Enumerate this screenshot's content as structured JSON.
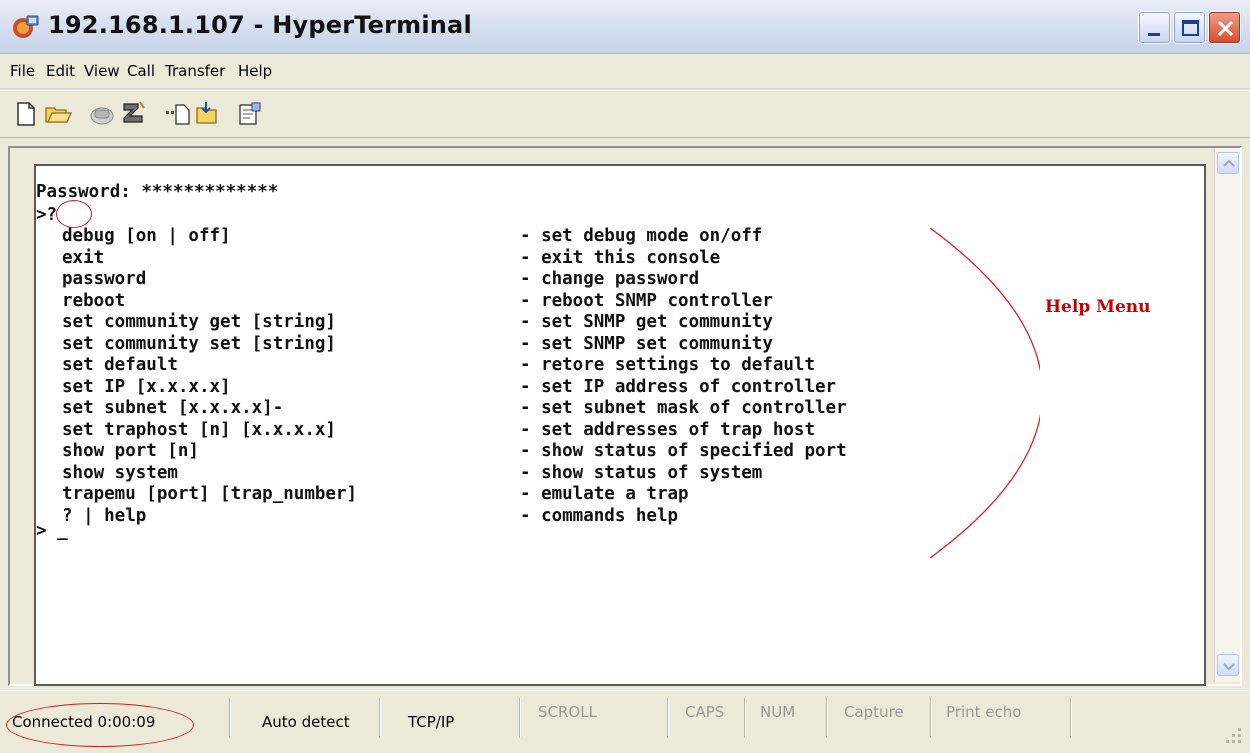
{
  "window": {
    "title": "192.168.1.107 - HyperTerminal",
    "controls": [
      "minimize",
      "maximize",
      "close"
    ]
  },
  "menu": {
    "items": [
      "File",
      "Edit",
      "View",
      "Call",
      "Transfer",
      "Help"
    ]
  },
  "toolbar": {
    "icons": [
      "new-file-icon",
      "open-folder-icon",
      "connect-phone-icon",
      "disconnect-phone-icon",
      "send-icon",
      "receive-icon",
      "properties-icon"
    ]
  },
  "terminal": {
    "password_line": "Password: *************",
    "prompt_help": ">?",
    "commands": [
      {
        "cmd": "debug [on | off]",
        "desc": "- set debug mode on/off"
      },
      {
        "cmd": "exit",
        "desc": "- exit this console"
      },
      {
        "cmd": "password",
        "desc": "- change password"
      },
      {
        "cmd": "reboot",
        "desc": "- reboot SNMP controller"
      },
      {
        "cmd": "set community get [string]",
        "desc": "- set SNMP get community"
      },
      {
        "cmd": "set community set [string]",
        "desc": "- set SNMP set community"
      },
      {
        "cmd": "set default",
        "desc": "- retore settings to default"
      },
      {
        "cmd": "set IP [x.x.x.x]",
        "desc": "- set IP address of controller"
      },
      {
        "cmd": "set subnet [x.x.x.x]-",
        "desc": "- set subnet mask of controller"
      },
      {
        "cmd": "set traphost [n] [x.x.x.x]",
        "desc": "- set addresses of trap host"
      },
      {
        "cmd": "show port [n]",
        "desc": "- show status of specified port"
      },
      {
        "cmd": "show system",
        "desc": "- show status of system"
      },
      {
        "cmd": "trapemu [port] [trap_number]",
        "desc": "- emulate a trap"
      },
      {
        "cmd": "? | help",
        "desc": "- commands help"
      }
    ],
    "final_prompt": "> _"
  },
  "annotation": {
    "label": "Help Menu",
    "color": "#c40000"
  },
  "status": {
    "connected": "Connected 0:00:09",
    "detect": "Auto detect",
    "protocol": "TCP/IP",
    "scroll": "SCROLL",
    "caps": "CAPS",
    "num": "NUM",
    "capture": "Capture",
    "print_echo": "Print echo"
  }
}
